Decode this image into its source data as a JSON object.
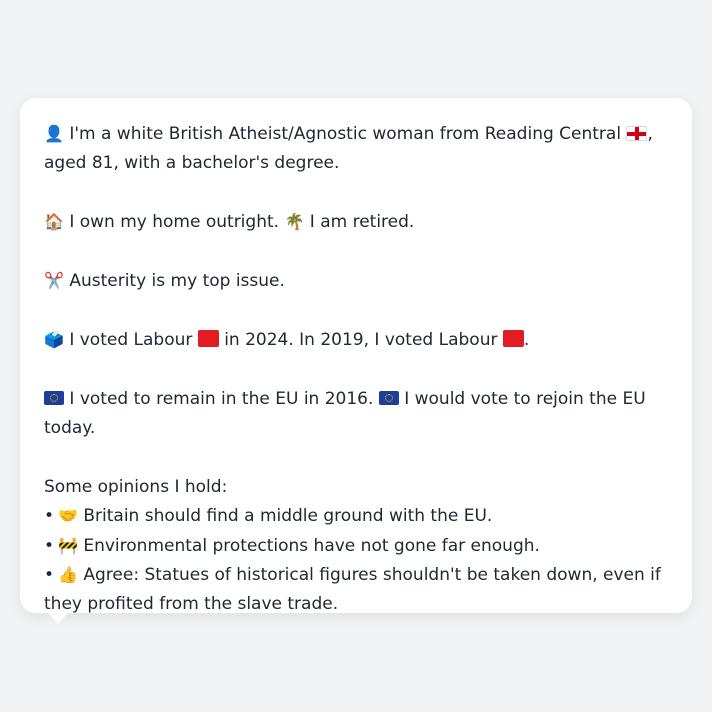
{
  "profile": {
    "line1": {
      "icon": "👤",
      "text": "I'm a white British Atheist/Agnostic woman from Reading Central",
      "flag": "england-flag",
      "suffix": ","
    },
    "line1b": "aged 81, with a bachelor's degree.",
    "home": {
      "icon": "🏠",
      "text": "I own my home outright.",
      "icon2": "🌴",
      "text2": "I am retired."
    },
    "issue": {
      "icon": "✂️",
      "text": "Austerity is my top issue."
    },
    "vote": {
      "icon": "🗳️",
      "text_a": "I voted Labour",
      "text_b": "in 2024. In 2019, I voted Labour",
      "text_c": ".",
      "party_color": "#e31b23"
    },
    "eu": {
      "text_a": "I voted to remain in the EU in 2016.",
      "text_b": "I would vote to rejoin the EU today."
    },
    "opinions_heading": "Some opinions I hold:",
    "opinions": [
      {
        "bullet": "•",
        "icon": "🤝",
        "text": "Britain should find a middle ground with the EU."
      },
      {
        "bullet": "•",
        "icon": "🚧",
        "text": "Environmental protections have not gone far enough."
      },
      {
        "bullet": "•",
        "icon": "👍",
        "text": "Agree: Statues of historical figures shouldn't be taken down, even if they profited from the slave trade."
      }
    ]
  },
  "colors": {
    "background": "#f2f3f5",
    "card": "#ffffff",
    "text": "#1f2733"
  }
}
